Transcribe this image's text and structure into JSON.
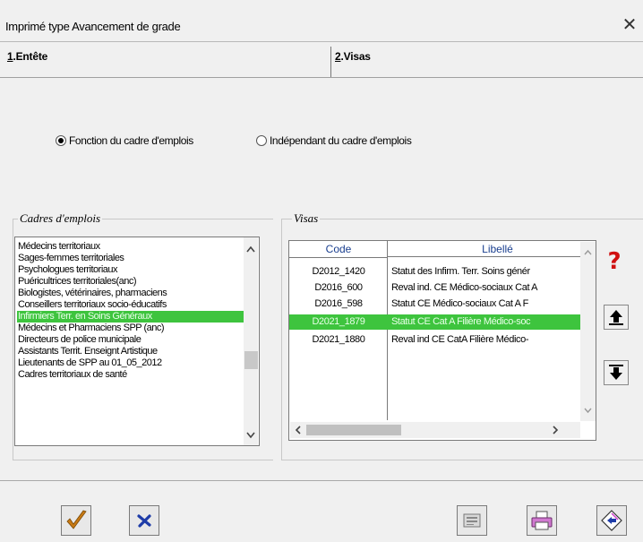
{
  "window": {
    "title": "Imprimé type Avancement de grade",
    "close_glyph": "✕"
  },
  "tabs": [
    {
      "num": "1",
      "label": ".Entête"
    },
    {
      "num": "2",
      "label": ".Visas"
    }
  ],
  "radios": [
    {
      "label": "Fonction du cadre d'emplois",
      "checked": true
    },
    {
      "label": "Indépendant du cadre d'emplois",
      "checked": false
    }
  ],
  "cadres": {
    "legend": "Cadres d'emplois",
    "items": [
      "Médecins territoriaux",
      "Sages-femmes territoriales",
      "Psychologues territoriaux",
      "Puéricultrices territoriales(anc)",
      "Biologistes, vétérinaires, pharmaciens",
      "Conseillers territoriaux socio-éducatifs",
      "Infirmiers Terr. en Soins Généraux",
      "Médecins et Pharmaciens SPP (anc)",
      "Directeurs de police municipale",
      "Assistants Territ. Enseignt Artistique",
      "Lieutenants de SPP au 01_05_2012",
      "Cadres territoriaux de santé"
    ],
    "selected_index": 6
  },
  "visas": {
    "legend": "Visas",
    "columns": [
      "Code",
      "Libellé"
    ],
    "rows": [
      {
        "code": "D2012_1420",
        "libelle": "Statut des Infirm. Terr. Soins génér"
      },
      {
        "code": "D2016_600",
        "libelle": "Reval ind. CE Médico-sociaux Cat A"
      },
      {
        "code": "D2016_598",
        "libelle": "Statut CE Médico-sociaux Cat A F"
      },
      {
        "code": "D2021_1879",
        "libelle": "Statut CE Cat A Filière Médico-soc"
      },
      {
        "code": "D2021_1880",
        "libelle": "Reval ind CE CatA Filière Médico-"
      }
    ],
    "selected_index": 3
  },
  "icons": {
    "help": "question-mark-icon",
    "up": "arrow-up-icon",
    "down": "arrow-down-icon",
    "ok": "checkmark-icon",
    "cancel": "cross-icon",
    "b3": "card-icon",
    "b4": "printer-icon",
    "b5": "return-icon"
  },
  "colors": {
    "selection": "#3ec43e",
    "header_text": "#1a3f8f",
    "help": "#d01010",
    "ok": "#c87a14",
    "cancel": "#1e3ca8"
  }
}
